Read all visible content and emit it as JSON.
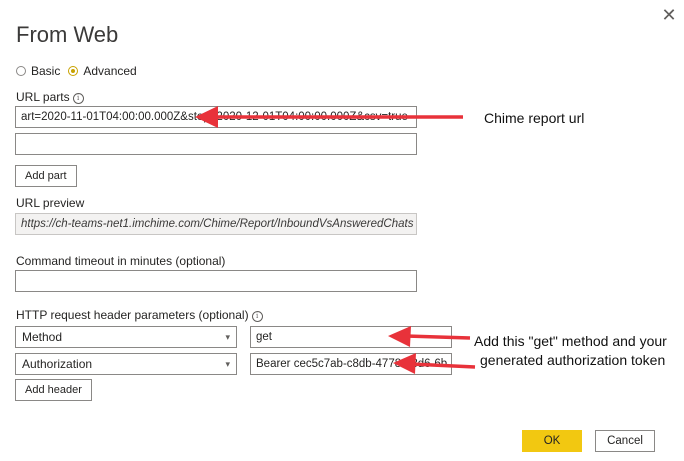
{
  "dialog": {
    "title": "From Web"
  },
  "icons": {
    "close": "close-icon",
    "info": "info-icon",
    "chevron": "chevron-down-icon"
  },
  "mode": {
    "options": [
      {
        "label": "Basic",
        "checked": false
      },
      {
        "label": "Advanced",
        "checked": true
      }
    ]
  },
  "url_parts": {
    "label": "URL parts",
    "parts": [
      "art=2020-11-01T04:00:00.000Z&stop=2020-12-01T04:00:00.000Z&csv=true",
      ""
    ],
    "add_label": "Add part"
  },
  "url_preview": {
    "label": "URL preview",
    "value": "https://ch-teams-net1.imchime.com/Chime/Report/InboundVsAnsweredChats"
  },
  "timeout": {
    "label": "Command timeout in minutes (optional)",
    "value": ""
  },
  "headers": {
    "label": "HTTP request header parameters (optional)",
    "rows": [
      {
        "name": "Method",
        "value": "get"
      },
      {
        "name": "Authorization",
        "value": "Bearer cec5c7ab-c8db-4778-b8d6-6b"
      }
    ],
    "add_label": "Add header"
  },
  "footer": {
    "ok_label": "OK",
    "cancel_label": "Cancel"
  },
  "annotations": {
    "url_note": "Chime report url",
    "header_note_line1": "Add this \"get\" method and your",
    "header_note_line2": "generated authorization token"
  },
  "colors": {
    "accent": "#f2c811",
    "arrow": "#e8323a"
  }
}
